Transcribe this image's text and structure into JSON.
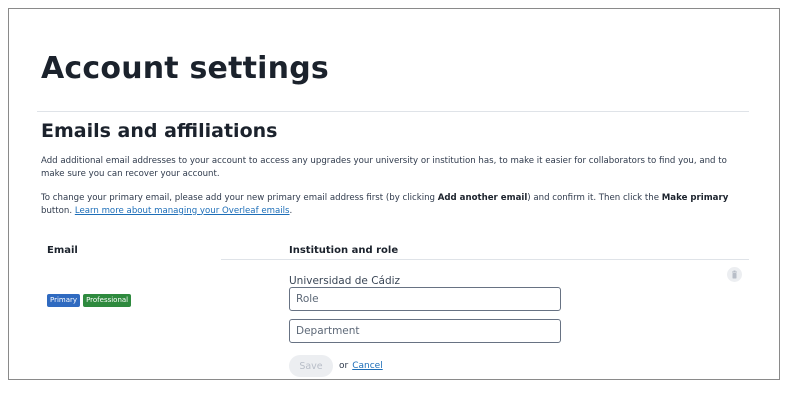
{
  "page": {
    "title": "Account settings"
  },
  "emails_section": {
    "title": "Emails and affiliations",
    "intro": "Add additional email addresses to your account to access any upgrades your university or institution has, to make it easier for collaborators to find you, and to make sure you can recover your account.",
    "change_primary": {
      "before_add": "To change your primary email, please add your new primary email address first (by clicking ",
      "add_another_label": "Add another email",
      "middle": ") and confirm it. Then click the ",
      "make_primary_label": "Make primary",
      "after": " button. ",
      "learn_more_link": "Learn more about managing your Overleaf emails",
      "period": "."
    },
    "table": {
      "email_header": "Email",
      "institution_header": "Institution and role"
    },
    "row": {
      "badges": {
        "primary": "Primary",
        "professional": "Professional"
      },
      "institution_name": "Universidad de Cádiz",
      "role_placeholder": "Role",
      "department_placeholder": "Department",
      "save_label": "Save",
      "or_text": "or",
      "cancel_label": "Cancel"
    }
  },
  "icons": {
    "delete": "trash-icon"
  }
}
